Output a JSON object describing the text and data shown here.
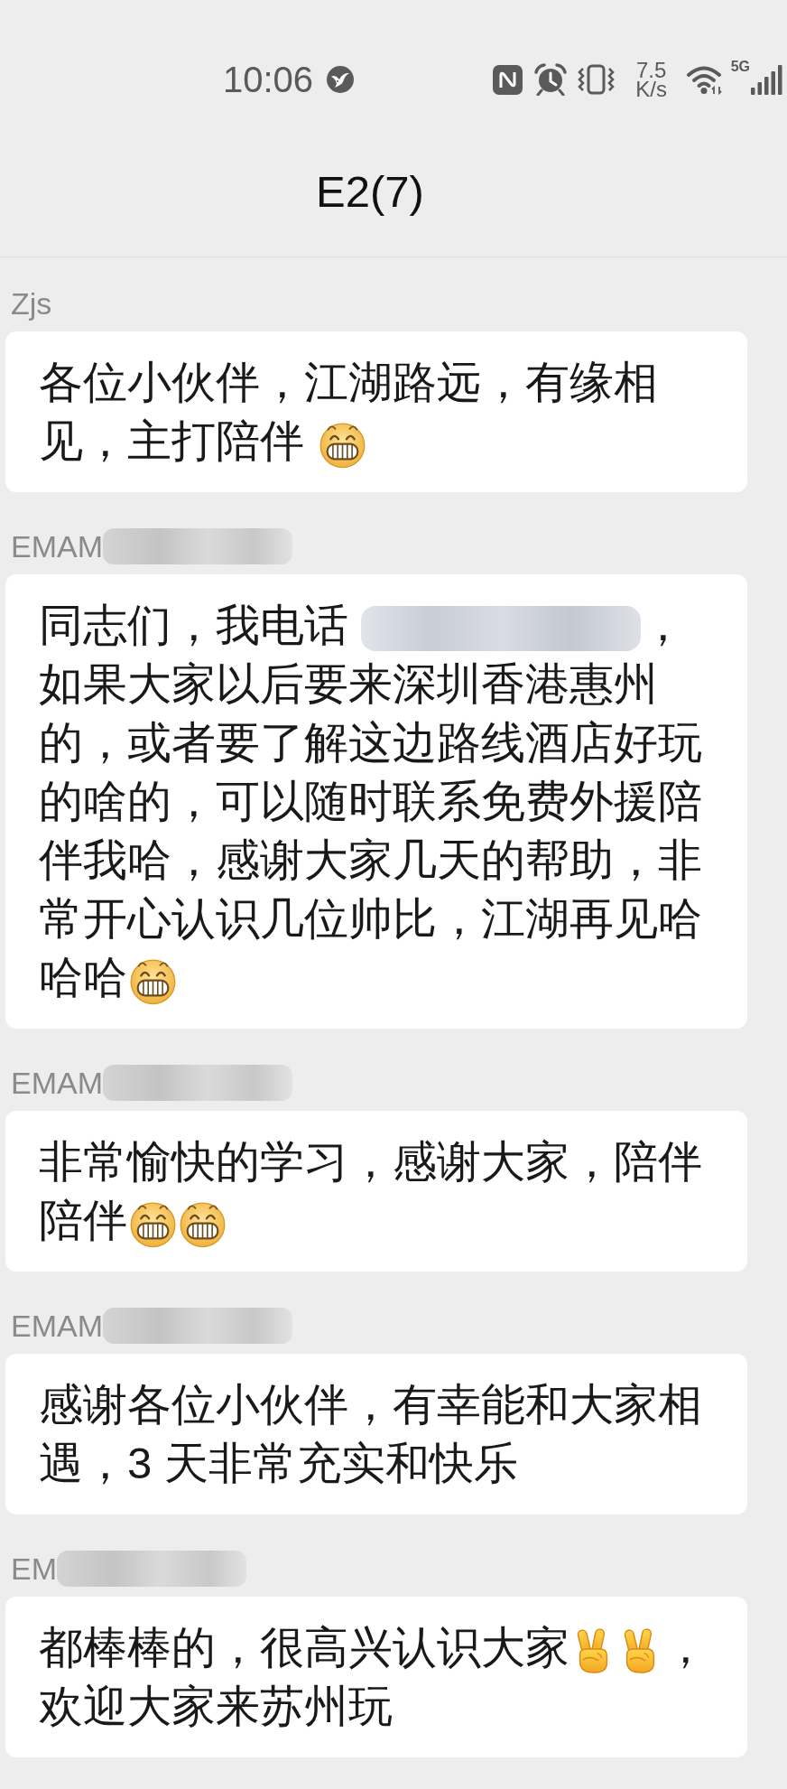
{
  "status_bar": {
    "time": "10:06",
    "net_speed": {
      "value": "7.5",
      "unit": "K/s"
    },
    "network_type": "5G"
  },
  "header": {
    "title": "E2(7)"
  },
  "messages": [
    {
      "sender": {
        "name": "Zjs",
        "redacted": false
      },
      "content": [
        {
          "kind": "text",
          "text": "各位小伙伴，江湖路远，有缘相见，主打陪伴 "
        },
        {
          "kind": "grin"
        }
      ]
    },
    {
      "sender": {
        "name": "EMAM",
        "redacted": true
      },
      "content": [
        {
          "kind": "text",
          "text": "同志们，我电话 "
        },
        {
          "kind": "redacted"
        },
        {
          "kind": "text",
          "text": "，如果大家以后要来深圳香港惠州的，或者要了解这边路线酒店好玩的啥的，可以随时联系免费外援陪伴我哈，感谢大家几天的帮助，非常开心认识几位帅比，江湖再见哈哈哈"
        },
        {
          "kind": "grin"
        }
      ]
    },
    {
      "sender": {
        "name": "EMAM",
        "redacted": true
      },
      "content": [
        {
          "kind": "text",
          "text": "非常愉快的学习，感谢大家，陪伴陪伴"
        },
        {
          "kind": "grin"
        },
        {
          "kind": "grin"
        }
      ]
    },
    {
      "sender": {
        "name": "EMAM",
        "redacted": true
      },
      "content": [
        {
          "kind": "text",
          "text": "感谢各位小伙伴，有幸能和大家相遇，3 天非常充实和快乐"
        }
      ]
    },
    {
      "sender": {
        "name": "EM",
        "redacted": true
      },
      "content": [
        {
          "kind": "text",
          "text": "都棒棒的，很高兴认识大家"
        },
        {
          "kind": "victory"
        },
        {
          "kind": "victory"
        },
        {
          "kind": "text",
          "text": "，欢迎大家来苏州玩"
        }
      ]
    }
  ]
}
